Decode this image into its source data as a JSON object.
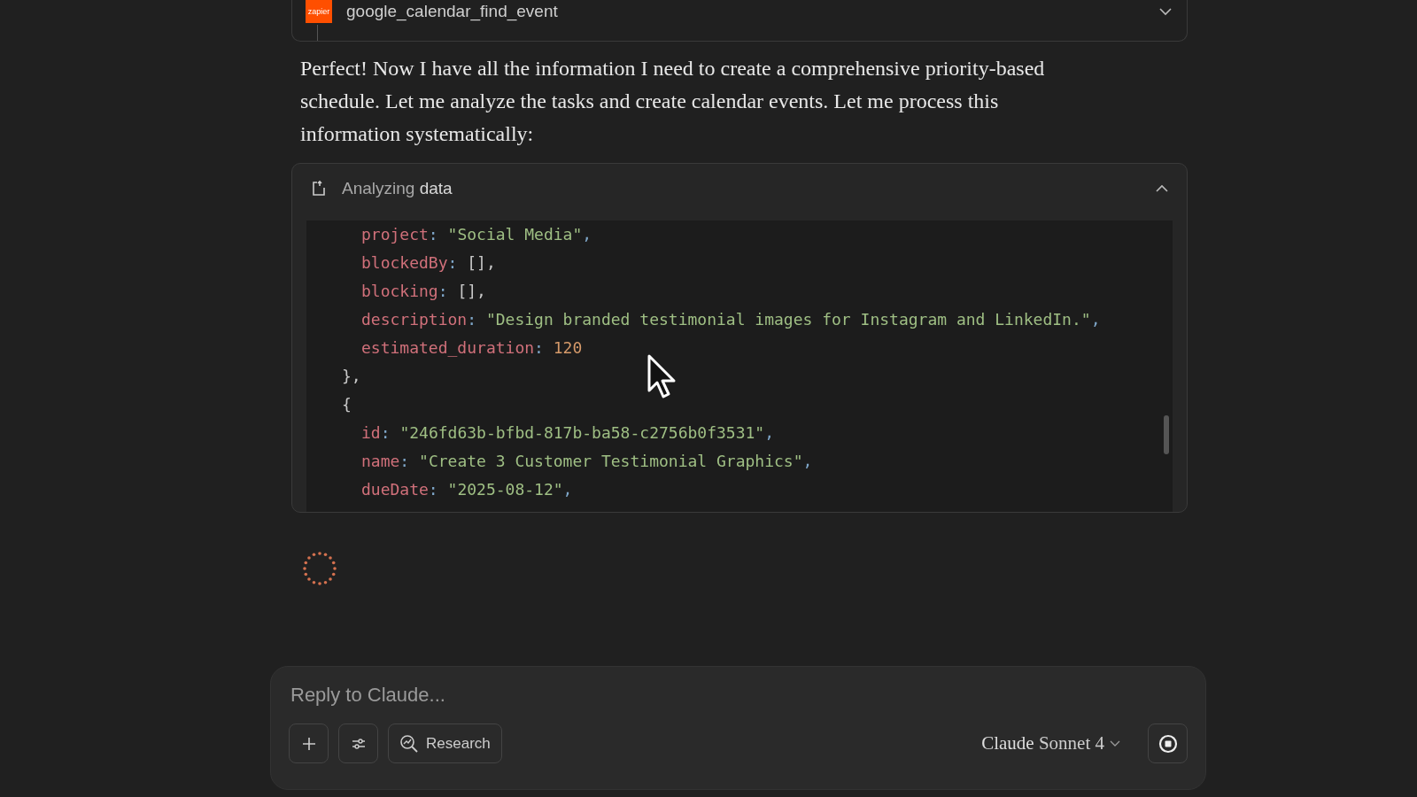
{
  "tool_call": {
    "logo_text": "zapier",
    "name": "google_calendar_find_event",
    "expanded": false
  },
  "message": "Perfect! Now I have all the information I need to create a comprehensive priority-based schedule. Let me analyze the tasks and create calendar events. Let me process this information systematically:",
  "analysis": {
    "title_prefix": "Analyzing",
    "title_word": "data",
    "expanded": true,
    "code_lines": [
      {
        "kind": "field",
        "tokens": [
          {
            "kind": "key",
            "text": "project"
          },
          {
            "kind": "punct",
            "text": ": "
          },
          {
            "kind": "string",
            "text": "\"Social Media\""
          },
          {
            "kind": "punct",
            "text": ","
          }
        ]
      },
      {
        "kind": "field",
        "tokens": [
          {
            "kind": "key",
            "text": "blockedBy"
          },
          {
            "kind": "punct",
            "text": ": "
          },
          {
            "kind": "plain",
            "text": "[],"
          }
        ]
      },
      {
        "kind": "field",
        "tokens": [
          {
            "kind": "key",
            "text": "blocking"
          },
          {
            "kind": "punct",
            "text": ": "
          },
          {
            "kind": "plain",
            "text": "[],"
          }
        ]
      },
      {
        "kind": "field",
        "tokens": [
          {
            "kind": "key",
            "text": "description"
          },
          {
            "kind": "punct",
            "text": ": "
          },
          {
            "kind": "string",
            "text": "\"Design branded testimonial images for Instagram and LinkedIn.\""
          },
          {
            "kind": "punct",
            "text": ","
          }
        ]
      },
      {
        "kind": "field",
        "tokens": [
          {
            "kind": "key",
            "text": "estimated_duration"
          },
          {
            "kind": "punct",
            "text": ": "
          },
          {
            "kind": "number",
            "text": "120"
          }
        ]
      },
      {
        "kind": "brace",
        "tokens": [
          {
            "kind": "plain",
            "text": "},"
          }
        ]
      },
      {
        "kind": "brace",
        "tokens": [
          {
            "kind": "plain",
            "text": "{"
          }
        ]
      },
      {
        "kind": "field",
        "tokens": [
          {
            "kind": "key",
            "text": "id"
          },
          {
            "kind": "punct",
            "text": ": "
          },
          {
            "kind": "string",
            "text": "\"246fd63b-bfbd-817b-ba58-c2756b0f3531\""
          },
          {
            "kind": "punct",
            "text": ","
          }
        ]
      },
      {
        "kind": "field",
        "tokens": [
          {
            "kind": "key",
            "text": "name"
          },
          {
            "kind": "punct",
            "text": ": "
          },
          {
            "kind": "string",
            "text": "\"Create 3 Customer Testimonial Graphics\""
          },
          {
            "kind": "punct",
            "text": ","
          }
        ]
      },
      {
        "kind": "field",
        "tokens": [
          {
            "kind": "key",
            "text": "dueDate"
          },
          {
            "kind": "punct",
            "text": ": "
          },
          {
            "kind": "string",
            "text": "\"2025-08-12\""
          },
          {
            "kind": "punct",
            "text": ","
          }
        ]
      }
    ]
  },
  "composer": {
    "placeholder": "Reply to Claude...",
    "research_label": "Research",
    "model_brand": "Claude",
    "model_name": "Sonnet 4"
  }
}
